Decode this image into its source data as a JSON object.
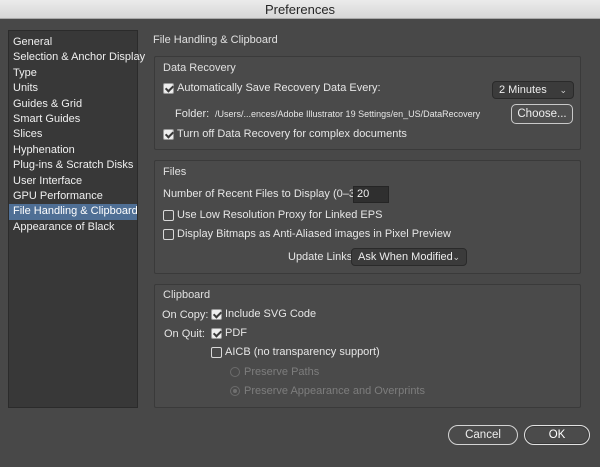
{
  "window": {
    "title": "Preferences"
  },
  "sidebar": {
    "items": [
      {
        "label": "General"
      },
      {
        "label": "Selection & Anchor Display"
      },
      {
        "label": "Type"
      },
      {
        "label": "Units"
      },
      {
        "label": "Guides & Grid"
      },
      {
        "label": "Smart Guides"
      },
      {
        "label": "Slices"
      },
      {
        "label": "Hyphenation"
      },
      {
        "label": "Plug-ins & Scratch Disks"
      },
      {
        "label": "User Interface"
      },
      {
        "label": "GPU Performance"
      },
      {
        "label": "File Handling & Clipboard",
        "selected": true
      },
      {
        "label": "Appearance of Black"
      }
    ]
  },
  "main": {
    "section_title": "File Handling & Clipboard",
    "data_recovery": {
      "label": "Data Recovery",
      "auto_save_label": "Automatically Save Recovery Data Every:",
      "auto_save_checked": true,
      "interval_value": "2 Minutes",
      "folder_label": "Folder:",
      "folder_path": "/Users/...ences/Adobe Illustrator 19 Settings/en_US/DataRecovery",
      "choose_label": "Choose...",
      "turn_off_label": "Turn off Data Recovery for complex documents",
      "turn_off_checked": true
    },
    "files": {
      "label": "Files",
      "recent_label": "Number of Recent Files to Display (0–30):",
      "recent_value": "20",
      "low_res_label": "Use Low Resolution Proxy for Linked EPS",
      "low_res_checked": false,
      "anti_alias_label": "Display Bitmaps as Anti-Aliased images in Pixel Preview",
      "anti_alias_checked": false,
      "update_links_label": "Update Links:",
      "update_links_value": "Ask When Modified"
    },
    "clipboard": {
      "label": "Clipboard",
      "on_copy_label": "On Copy:",
      "include_svg_label": "Include SVG Code",
      "include_svg_checked": true,
      "on_quit_label": "On Quit:",
      "pdf_label": "PDF",
      "pdf_checked": true,
      "aicb_label": "AICB (no transparency support)",
      "aicb_checked": false,
      "preserve_paths_label": "Preserve Paths",
      "preserve_appearance_label": "Preserve Appearance and Overprints"
    }
  },
  "footer": {
    "cancel_label": "Cancel",
    "ok_label": "OK"
  },
  "colors": {
    "selection": "#4f6f95",
    "window_bg": "#484848"
  },
  "icons": {
    "dropdown": "chevron-down-icon",
    "checkbox": "checkmark-icon"
  }
}
